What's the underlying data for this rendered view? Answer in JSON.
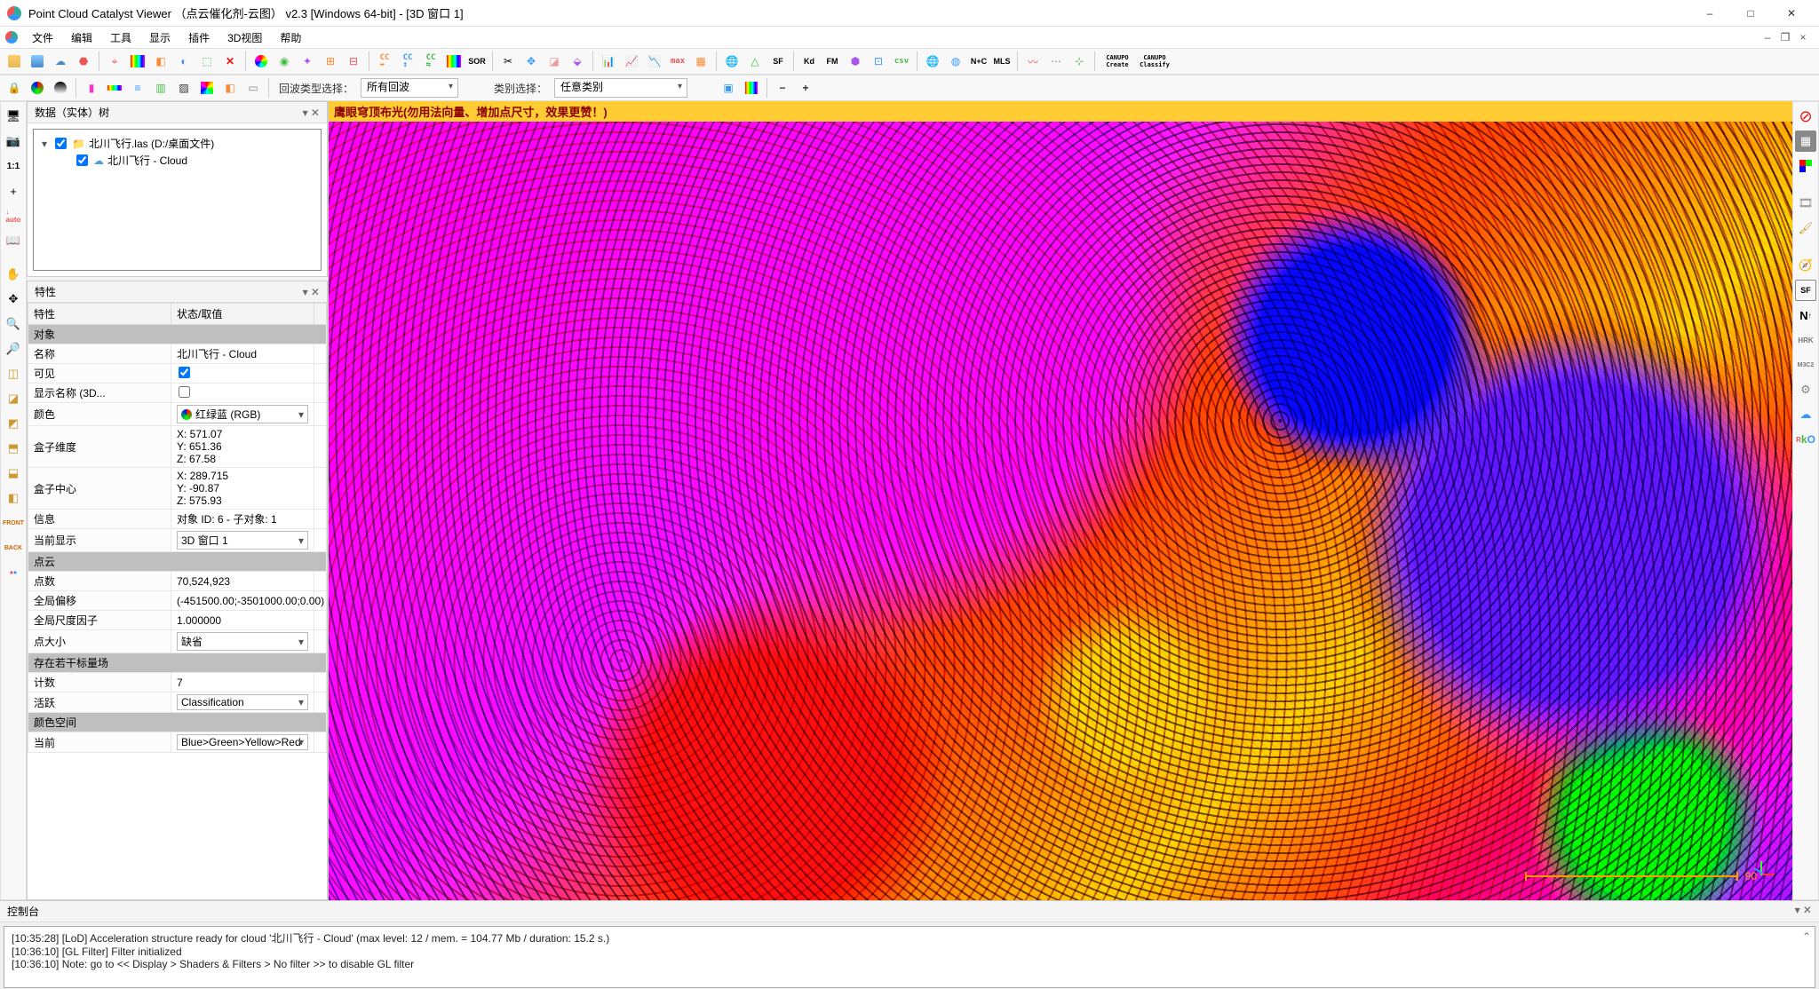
{
  "window": {
    "title": "Point Cloud Catalyst Viewer  （点云催化剂-云图）  v2.3  [Windows 64-bit] - [3D 窗口 1]"
  },
  "menus": [
    "文件",
    "编辑",
    "工具",
    "显示",
    "插件",
    "3D视图",
    "帮助"
  ],
  "toolbar2": {
    "echo_label": "回波类型选择：",
    "echo_value": "所有回波",
    "class_label": "类别选择：",
    "class_value": "任意类别"
  },
  "toolbar1_text": {
    "sor": "SOR",
    "kd": "Kd",
    "fm": "FM",
    "nc": "N+C",
    "mls": "MLS",
    "can1": "CANUPO\\nCreate",
    "can2": "CANUPO\\nClassify",
    "sf": "SF"
  },
  "dbtree": {
    "title": "数据（实体）树",
    "items": [
      {
        "label": "北川飞行.las (D:/桌面文件)",
        "icon": "folder",
        "checked": true,
        "depth": 0,
        "twist": "▾"
      },
      {
        "label": "北川飞行 - Cloud",
        "icon": "cloud",
        "checked": true,
        "depth": 1,
        "twist": ""
      }
    ]
  },
  "props": {
    "title": "特性",
    "header": {
      "k": "特性",
      "v": "状态/取值"
    },
    "sections": [
      {
        "section": "对象"
      },
      {
        "k": "名称",
        "v": "北川飞行 - Cloud"
      },
      {
        "k": "可见",
        "checkbox": true,
        "checked": true
      },
      {
        "k": "显示名称 (3D...",
        "checkbox": true,
        "checked": false
      },
      {
        "k": "颜色",
        "combo": "红绿蓝 (RGB)",
        "icon": "rgb"
      },
      {
        "k": "盒子维度",
        "multiline": [
          "X: 571.07",
          "Y: 651.36",
          "Z: 67.58"
        ]
      },
      {
        "k": "盒子中心",
        "multiline": [
          "X: 289.715",
          "Y: -90.87",
          "Z: 575.93"
        ]
      },
      {
        "k": "信息",
        "v": "对象 ID: 6 - 子对象: 1"
      },
      {
        "k": "当前显示",
        "combo": "3D 窗口 1"
      },
      {
        "section": "点云"
      },
      {
        "k": "点数",
        "v": "70,524,923"
      },
      {
        "k": "全局偏移",
        "v": "(-451500.00;-3501000.00;0.00)"
      },
      {
        "k": "全局尺度因子",
        "v": "1.000000"
      },
      {
        "k": "点大小",
        "combo": "缺省"
      },
      {
        "section": "存在若干标量场"
      },
      {
        "k": "计数",
        "v": "7"
      },
      {
        "k": "活跃",
        "combo": "Classification"
      },
      {
        "section": "颜色空间"
      },
      {
        "k": "当前",
        "combo": "Blue>Green>Yellow>Red"
      }
    ]
  },
  "viewer": {
    "banner": "鹰眼穹顶布光(勿用法向量、增加点尺寸，效果更赞！)",
    "scale": "90"
  },
  "console": {
    "title": "控制台",
    "lines": [
      "[10:35:28] [LoD] Acceleration structure ready for cloud '北川飞行 - Cloud' (max level: 12 / mem. = 104.77 Mb / duration: 15.2 s.)",
      "[10:36:10] [GL Filter] Filter initialized",
      "[10:36:10] Note: go to << Display > Shaders & Filters > No filter >> to disable GL filter"
    ]
  },
  "left_sidebar": [
    "monitor",
    "camera",
    "1:1",
    "plus",
    "auto",
    "book",
    "hand",
    "move",
    "zoom",
    "zoom-in",
    "cube1",
    "cube2",
    "cube3",
    "cube4",
    "cube5",
    "cube6",
    "front",
    "back",
    "flickr"
  ],
  "right_sidebar": [
    "forbid",
    "grid",
    "rgb-sq",
    "film",
    "brush",
    "compass",
    "sf",
    "north",
    "hrk",
    "m3c2",
    "gear",
    "cloud",
    "rko"
  ]
}
